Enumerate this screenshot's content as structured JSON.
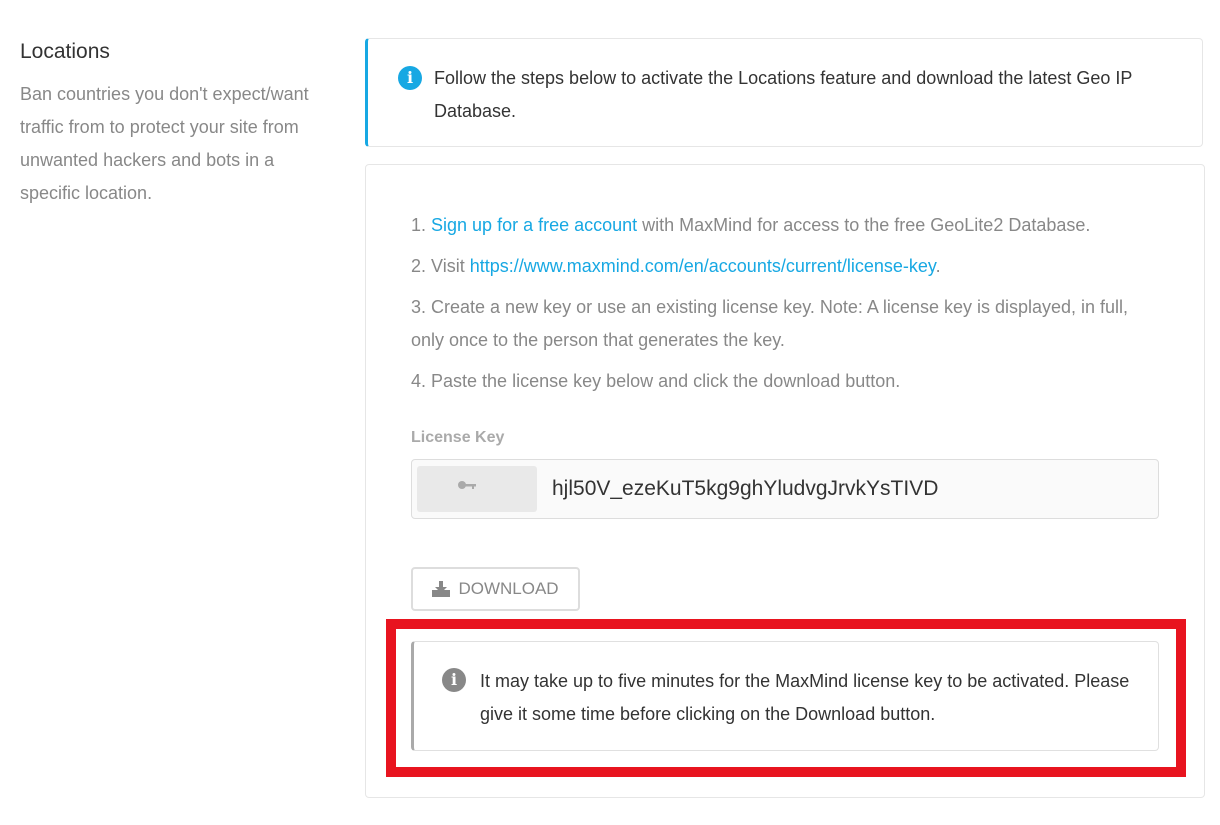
{
  "section": {
    "title": "Locations",
    "description": "Ban countries you don't expect/want traffic from to protect your site from unwanted hackers and bots in a specific location."
  },
  "top_notice": {
    "icon": "info-icon",
    "text": "Follow the steps below to activate the Locations feature and download the latest Geo IP Database."
  },
  "steps": {
    "s1_prefix": "1. ",
    "s1_link": "Sign up for a free account",
    "s1_suffix": " with MaxMind for access to the free GeoLite2 Database.",
    "s2_prefix": "2. Visit ",
    "s2_link": "https://www.maxmind.com/en/accounts/current/license-key",
    "s2_suffix": ".",
    "s3": "3. Create a new key or use an existing license key. Note: A license key is displayed, in full, only once to the person that generates the key.",
    "s4": "4. Paste the license key below and click the download button."
  },
  "license": {
    "label": "License Key",
    "value": "hjl50V_ezeKuT5kg9ghYludvgJrvkYsTIVD",
    "icon": "key-icon"
  },
  "download_button": {
    "label": "DOWNLOAD",
    "icon": "download-icon"
  },
  "bottom_notice": {
    "icon": "info-icon",
    "text": "It may take up to five minutes for the MaxMind license key to be activated. Please give it some time before clicking on the Download button."
  },
  "colors": {
    "accent": "#17a8e3",
    "highlight": "#e8141f"
  }
}
